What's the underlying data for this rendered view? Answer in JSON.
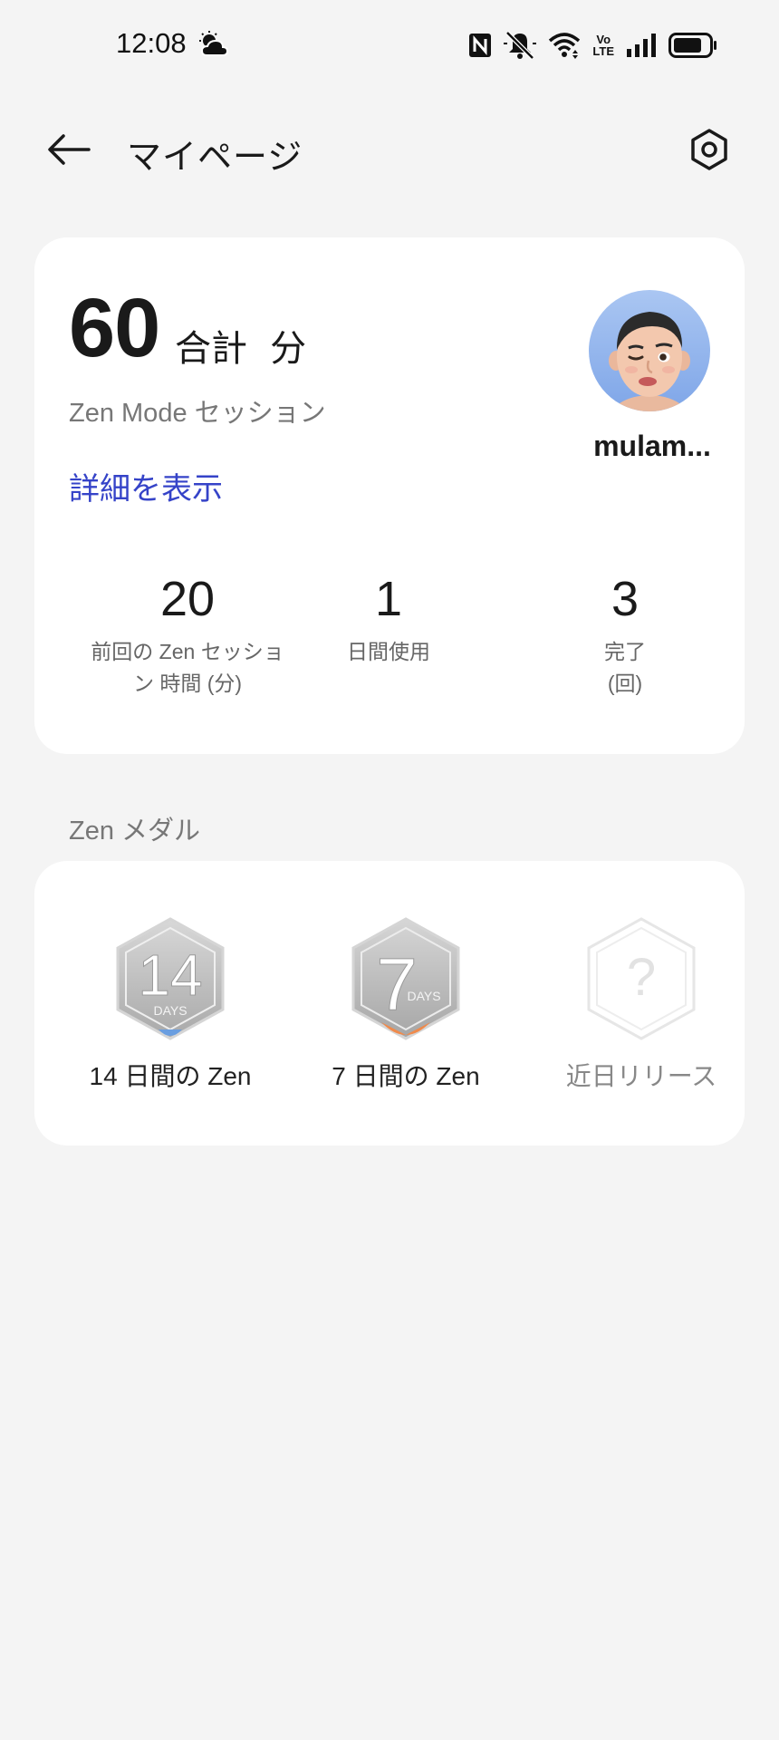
{
  "status_bar": {
    "time": "12:08",
    "icons": [
      "weather-icon",
      "nfc-icon",
      "silent-icon",
      "wifi-icon",
      "volte-icon",
      "signal-icon",
      "battery-icon"
    ],
    "volte_line1": "Vo",
    "volte_line2": "LTE"
  },
  "header": {
    "title": "マイページ",
    "back_icon": "arrow-left-icon",
    "settings_icon": "settings-icon"
  },
  "summary": {
    "total_value": "60",
    "total_unit": "合計 分",
    "session_label": "Zen Mode セッション",
    "details_link": "詳細を表示",
    "username": "mulam..."
  },
  "stats": [
    {
      "value": "20",
      "label": "前回の Zen セッショ",
      "label2": "ン 時間 (分)"
    },
    {
      "value": "1",
      "label": "日間使用",
      "label2": ""
    },
    {
      "value": "3",
      "label": "完了",
      "label2": "(回)"
    }
  ],
  "medals_section": {
    "title": "Zen メダル",
    "medals": [
      {
        "badge_text": "14",
        "badge_sub": "DAYS",
        "label": "14 日間の Zen",
        "accent": "#6a9ee0"
      },
      {
        "badge_text": "7",
        "badge_sub": "DAYS",
        "label": "7 日間の Zen",
        "accent": "#f08a4b"
      },
      {
        "badge_text": "?",
        "label": "近日リリース",
        "accent": "#e6e6e6"
      }
    ]
  },
  "colors": {
    "background": "#f4f4f4",
    "card": "#ffffff",
    "link": "#3543c8",
    "muted_text": "#777777"
  }
}
